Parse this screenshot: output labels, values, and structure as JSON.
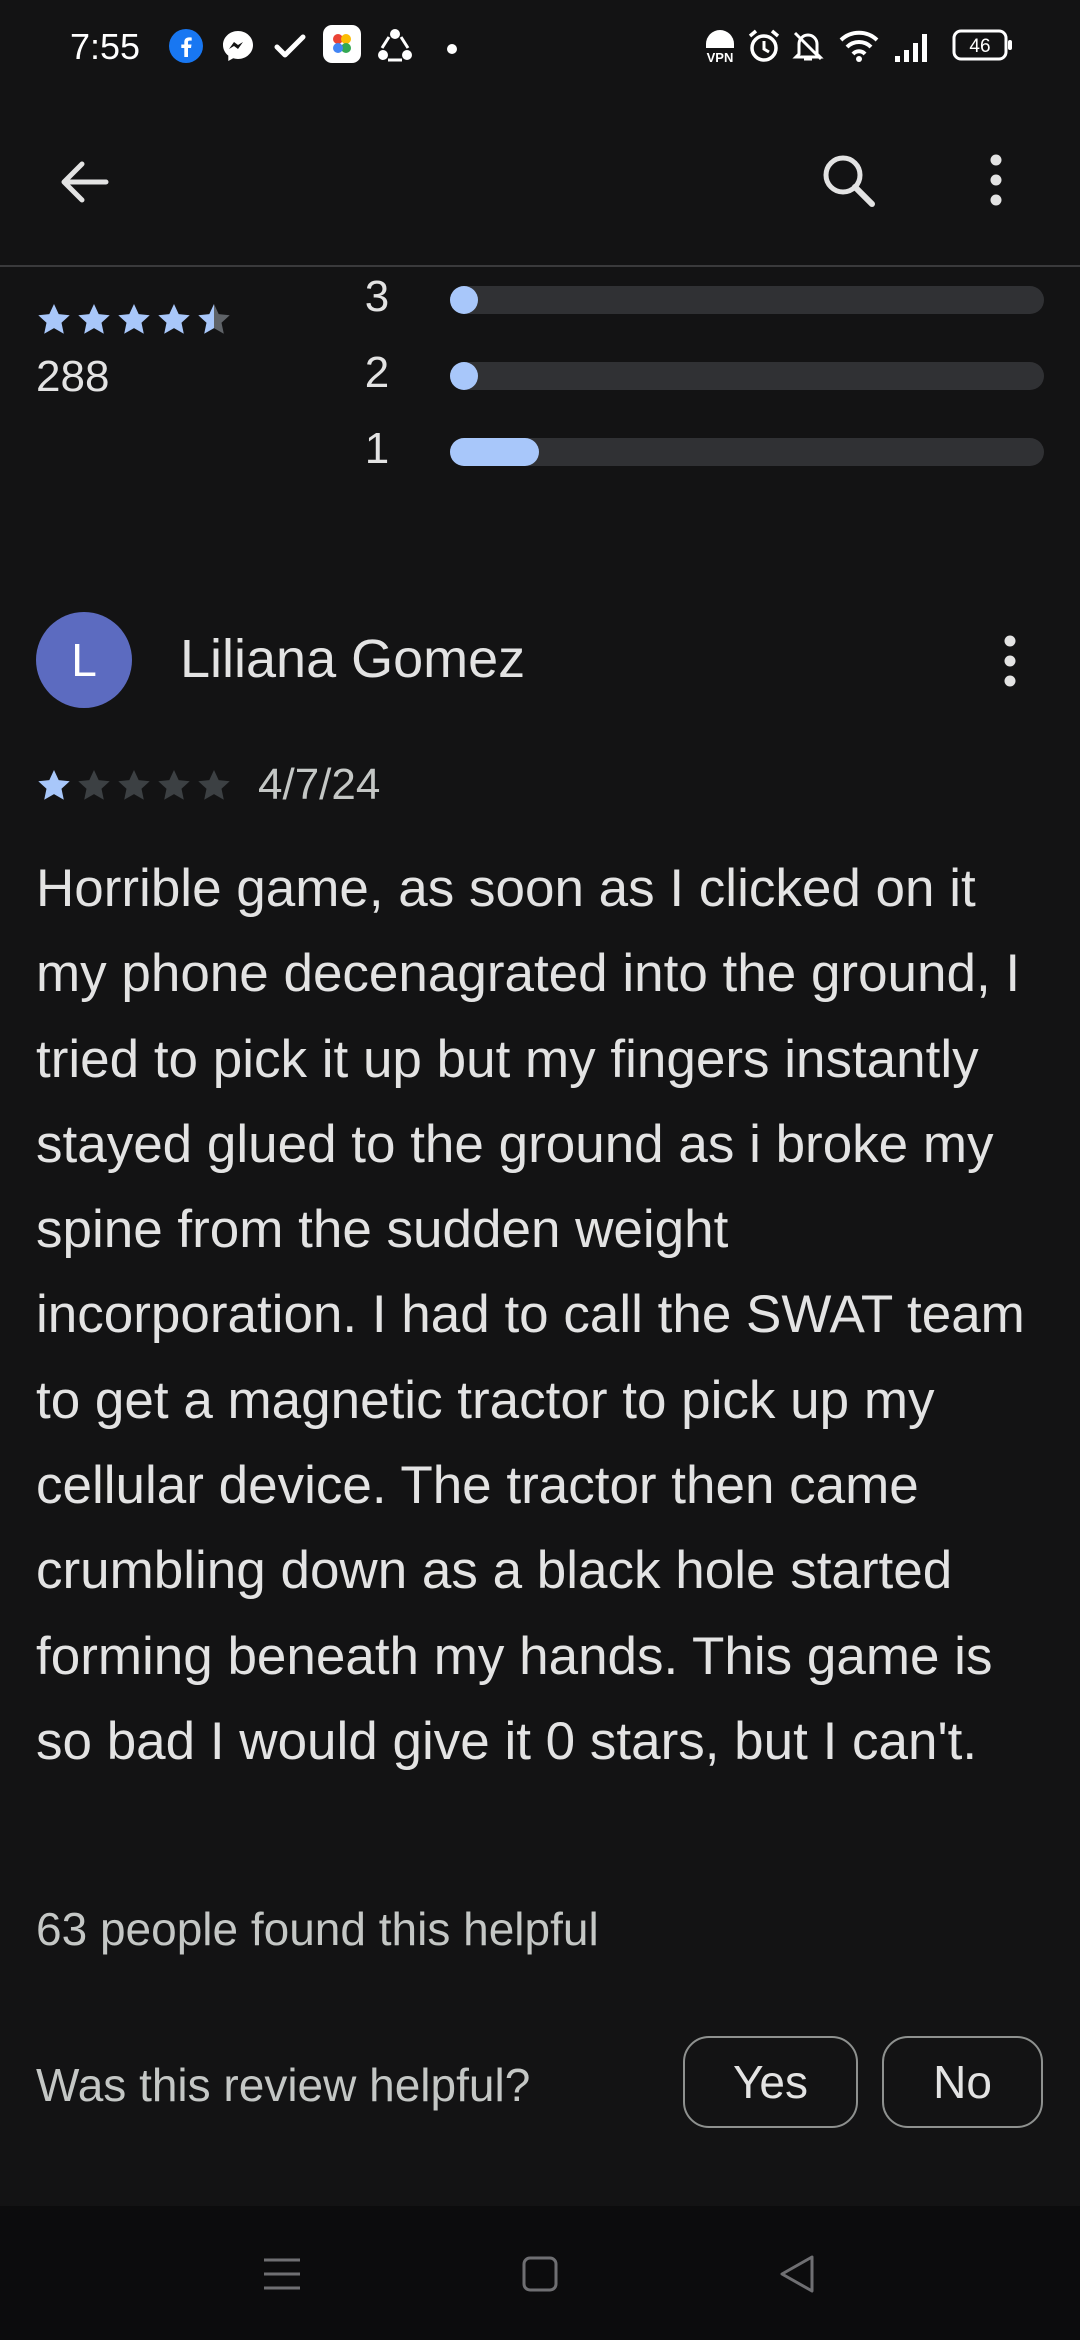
{
  "status_bar": {
    "time": "7:55",
    "battery": "46",
    "vpn_label": "VPN",
    "icons": [
      "facebook-icon",
      "messenger-icon",
      "check-icon",
      "photos-icon",
      "sync-icon",
      "dot-icon",
      "vpn-icon",
      "alarm-icon",
      "bell-off-icon",
      "wifi-icon",
      "signal-icon",
      "battery-icon"
    ]
  },
  "toolbar": {
    "icons": [
      "back-arrow-icon",
      "search-icon",
      "more-vert-icon"
    ]
  },
  "rating_summary": {
    "stars": 4.5,
    "count": "288",
    "bars": [
      {
        "label": "3",
        "fraction": 0.0
      },
      {
        "label": "2",
        "fraction": 0.0
      },
      {
        "label": "1",
        "fraction": 0.15
      }
    ]
  },
  "review": {
    "avatar_letter": "L",
    "author": "Liliana Gomez",
    "stars": 1,
    "date": "4/7/24",
    "text": "Horrible game, as soon as I clicked on it my phone decenagrated into the ground, I tried to pick it up but my fingers instantly stayed glued to the ground as i broke my spine from the sudden weight incorporation. I had to call the SWAT team to get a magnetic tractor to pick up my cellular device. The tractor then came crumbling down as a black hole started forming beneath my hands. This game is so bad I would give it 0 stars, but I can't.",
    "helpful_count": "63 people found this helpful",
    "helpful_question": "Was this review helpful?",
    "yes_label": "Yes",
    "no_label": "No"
  },
  "colors": {
    "background": "#131314",
    "accent": "#a8c7fa",
    "avatar": "#5c6bc0",
    "star_empty": "#5f6368"
  },
  "nav_bar": {
    "icons": [
      "recents-icon",
      "home-icon",
      "back-icon"
    ]
  }
}
